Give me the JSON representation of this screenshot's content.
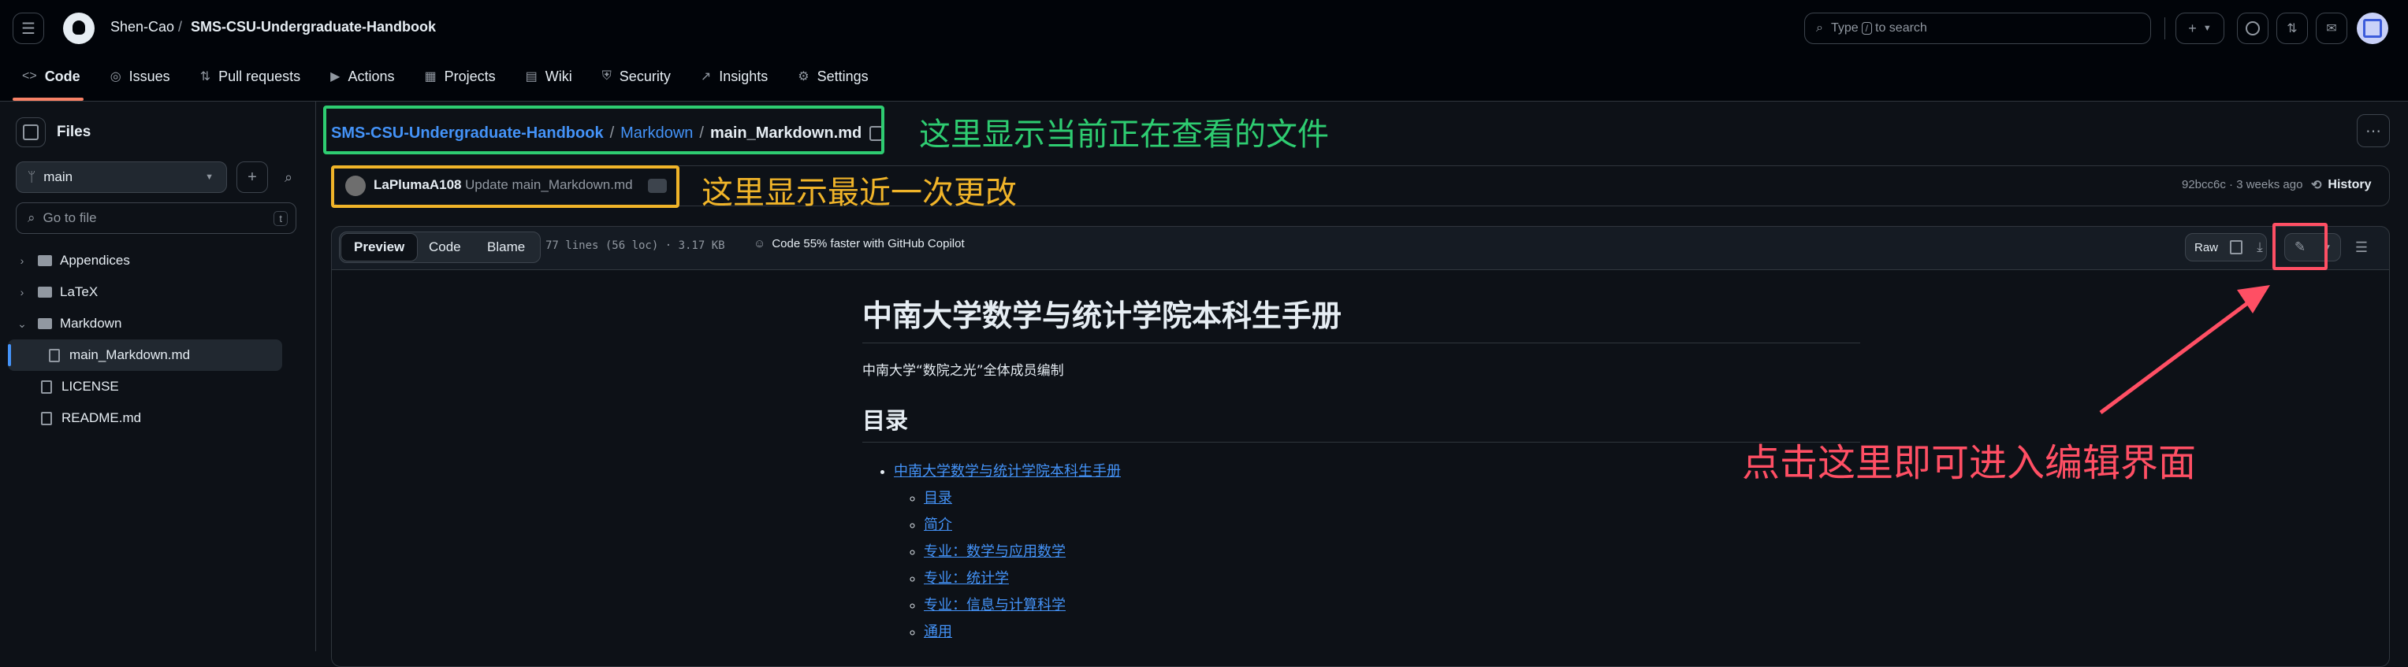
{
  "header": {
    "owner": "Shen-Cao",
    "separator": "/",
    "repo": "SMS-CSU-Undergraduate-Handbook",
    "search_before": "Type",
    "search_key": "/",
    "search_after": "to search"
  },
  "nav": {
    "code": "Code",
    "issues": "Issues",
    "pull_requests": "Pull requests",
    "actions": "Actions",
    "projects": "Projects",
    "wiki": "Wiki",
    "security": "Security",
    "insights": "Insights",
    "settings": "Settings"
  },
  "sidebar": {
    "title": "Files",
    "branch": "main",
    "go_to_file": "Go to file",
    "shortcut": "t",
    "tree": [
      {
        "label": "Appendices"
      },
      {
        "label": "LaTeX"
      },
      {
        "label": "Markdown"
      },
      {
        "label": "main_Markdown.md"
      },
      {
        "label": "LICENSE"
      },
      {
        "label": "README.md"
      }
    ]
  },
  "breadcrumb": {
    "repo": "SMS-CSU-Undergraduate-Handbook",
    "folder": "Markdown",
    "file": "main_Markdown.md",
    "sep1": "/",
    "sep2": "/"
  },
  "commit": {
    "author": "LaPlumaA108",
    "message": "Update main_Markdown.md",
    "meta": "92bcc6c · 3 weeks ago",
    "history": "History"
  },
  "file_header": {
    "tab_preview": "Preview",
    "tab_code": "Code",
    "tab_blame": "Blame",
    "stats": "77 lines (56 loc) · 3.17 KB",
    "copilot": "Code 55% faster with GitHub Copilot",
    "raw": "Raw"
  },
  "document": {
    "h1": "中南大学数学与统计学院本科生手册",
    "subtitle": "中南大学“数院之光”全体成员编制",
    "h2": "目录",
    "toc_top": "中南大学数学与统计学院本科生手册",
    "toc_items": [
      "目录",
      "简介",
      "专业：数学与应用数学",
      "专业：统计学",
      "专业：信息与计算科学",
      "通用"
    ]
  },
  "annotations": {
    "file_note": "这里显示当前正在查看的文件",
    "commit_note": "这里显示最近一次更改",
    "edit_note": "点击这里即可进入编辑界面",
    "green": "#2ecc71",
    "orange": "#f0b429",
    "red": "#ff4f64"
  }
}
